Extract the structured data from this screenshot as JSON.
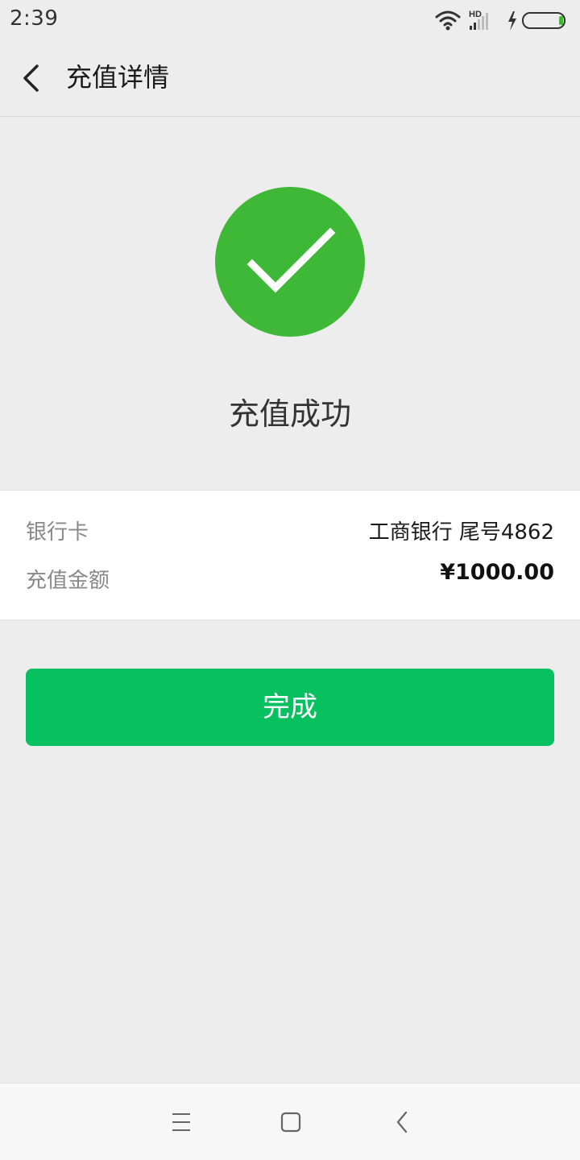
{
  "status_bar": {
    "time": "2:39",
    "network_label": "HD"
  },
  "nav": {
    "title": "充值详情",
    "back_icon": "chevron-left-icon"
  },
  "result": {
    "icon": "check-circle-icon",
    "icon_color": "#3fb838",
    "message": "充值成功"
  },
  "details": {
    "bank_label": "银行卡",
    "bank_value": "工商银行 尾号4862",
    "amount_label": "充值金额",
    "amount_value": "¥1000.00"
  },
  "actions": {
    "done_label": "完成",
    "done_color": "#07c160"
  },
  "system_nav": {
    "menu_icon": "menu-icon",
    "home_icon": "home-square-icon",
    "back_icon": "back-triangle-icon"
  }
}
